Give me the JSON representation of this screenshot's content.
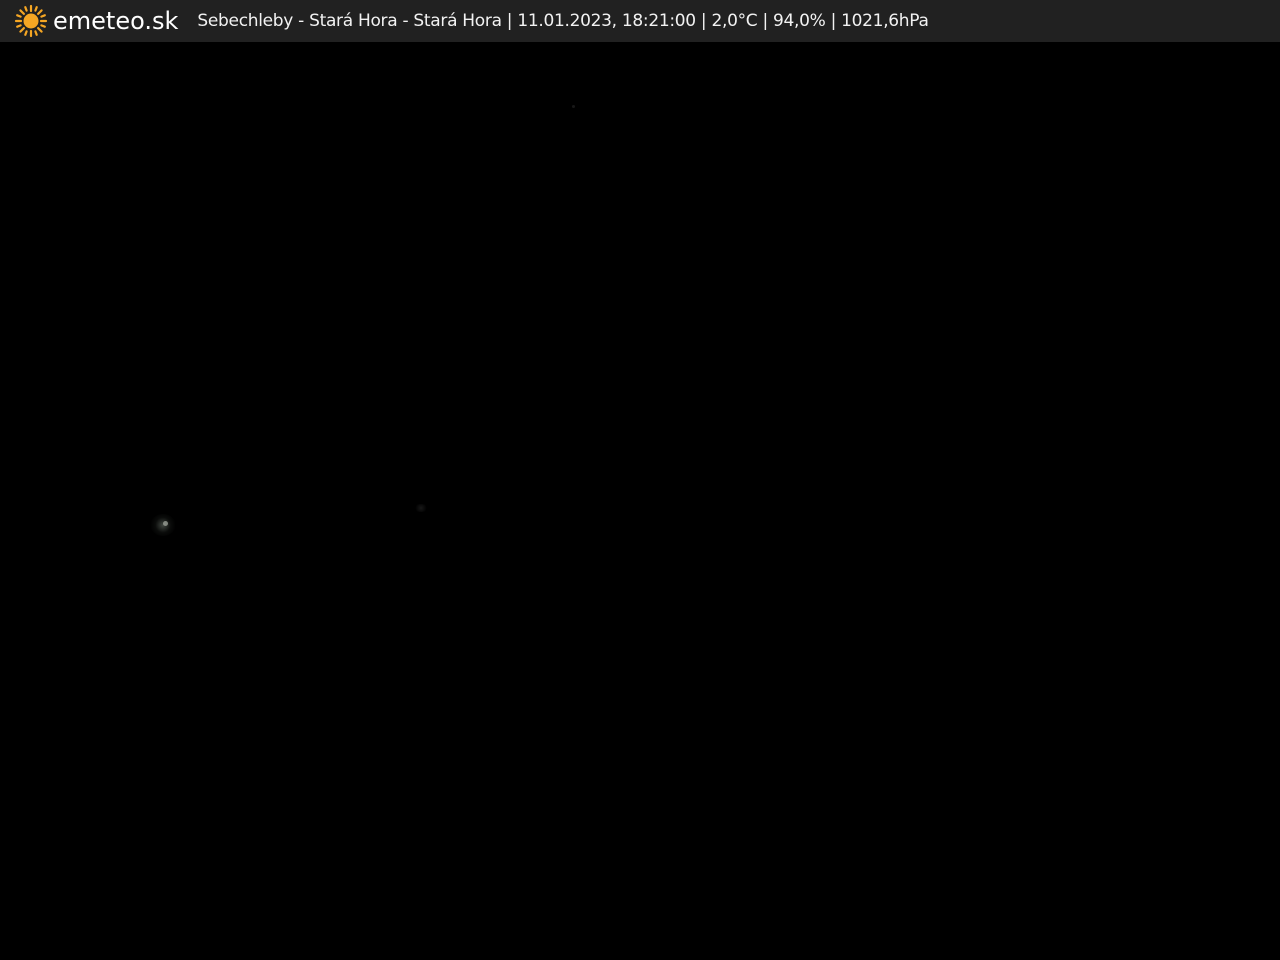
{
  "header": {
    "logo_icon": "sun-icon",
    "logo_text": "emeteo.sk",
    "caption": "Sebechleby - Stará Hora - Stará Hora | 11.01.2023, 18:21:00 | 2,0°C | 94,0% | 1021,6hPa"
  },
  "colors": {
    "bar": "#212121",
    "sun": "#f5a623",
    "background": "#000000"
  },
  "image": {
    "scene": "night webcam view"
  }
}
